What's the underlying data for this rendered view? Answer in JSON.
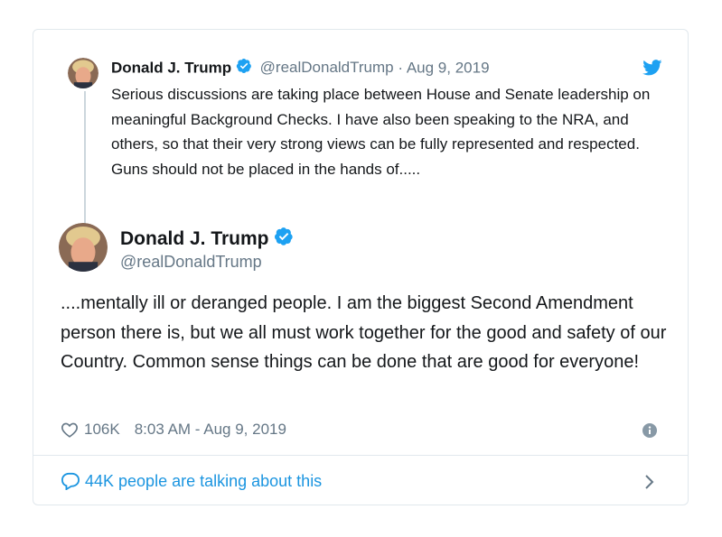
{
  "quoted_tweet": {
    "name": "Donald J. Trump",
    "handle": "@realDonaldTrump",
    "separator": "·",
    "date": "Aug 9, 2019",
    "text": "Serious discussions are taking place between House and Senate leadership  on meaningful Background Checks. I have also been speaking to the NRA, and others, so that their very strong views can be fully represented and respected. Guns should not be placed in the hands of....."
  },
  "main_tweet": {
    "name": "Donald J. Trump",
    "handle": "@realDonaldTrump",
    "text": "....mentally ill or deranged people. I am the biggest Second Amendment person there is, but we all must work together for the good and safety of our Country. Common sense things can be done that are good for everyone!",
    "likes": "106K",
    "timestamp": "8:03 AM - Aug 9, 2019"
  },
  "footer": {
    "talking_text": "44K people are talking about this"
  },
  "colors": {
    "accent": "#1da1f2",
    "link": "#1b95e0",
    "muted": "#657786",
    "border": "#e1e8ed"
  },
  "icons": [
    "avatar",
    "verified-badge-icon",
    "twitter-bird-icon",
    "heart-icon",
    "info-icon",
    "reply-bubble-icon",
    "chevron-right-icon"
  ]
}
